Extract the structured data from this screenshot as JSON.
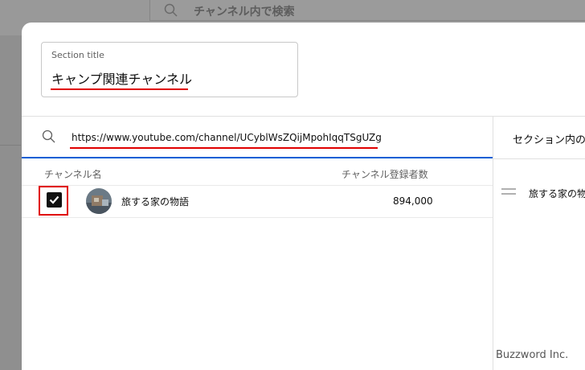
{
  "background": {
    "search_placeholder": "チャンネル内で検索",
    "icon": "search-icon"
  },
  "dialog": {
    "section_title": {
      "label": "Section title",
      "value": "キャンプ関連チャンネル"
    },
    "search": {
      "icon": "search-icon",
      "value": "https://www.youtube.com/channel/UCyblWsZQijMpohIqqTSgUZg"
    },
    "table": {
      "columns": [
        "チャンネル名",
        "チャンネル登録者数"
      ],
      "rows": [
        {
          "checked": true,
          "avatar": "channel-avatar",
          "name": "旅する家の物語",
          "subscribers": "894,000"
        }
      ]
    },
    "right_panel": {
      "tab_label": "セクション内の",
      "items": [
        "旅する家の物"
      ]
    }
  },
  "watermark": "Buzzword Inc.",
  "colors": {
    "accent_blue": "#065fd4",
    "highlight_red": "#e00000",
    "overlay_gray": "#8d8d8d"
  }
}
